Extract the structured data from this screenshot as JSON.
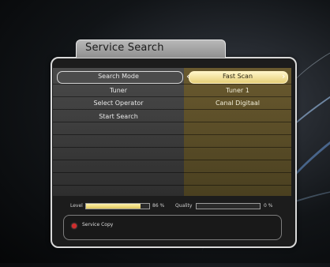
{
  "dialog": {
    "title": "Service Search"
  },
  "rows": [
    {
      "label": "Search Mode",
      "value": "Fast Scan",
      "selected": true
    },
    {
      "label": "Tuner",
      "value": "Tuner 1"
    },
    {
      "label": "Select Operator",
      "value": "Canal Digitaal"
    },
    {
      "label": "Start Search",
      "value": ""
    }
  ],
  "signal": {
    "level_label": "Level",
    "level_value": "86 %",
    "level_fraction": 0.86,
    "quality_label": "Quality",
    "quality_value": "0 %",
    "quality_fraction": 0.0
  },
  "footer": {
    "red_button_label": "Service Copy"
  },
  "colors": {
    "selected_value_bg": "#e6cf78",
    "right_column": "#4a4020",
    "red_key": "#d22b2b"
  },
  "icons": {
    "left_arrow": "chevron-left-icon",
    "right_arrow": "chevron-right-icon",
    "red_key": "red-button-icon"
  }
}
